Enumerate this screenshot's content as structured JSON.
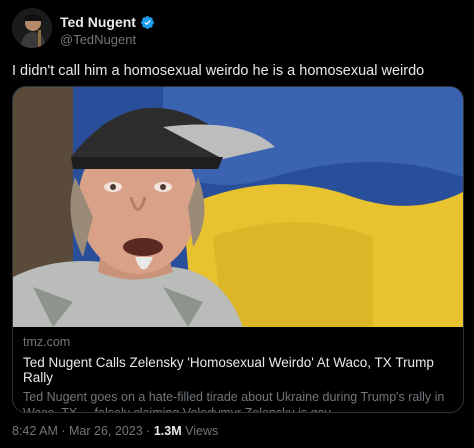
{
  "author": {
    "name": "Ted Nugent",
    "handle": "@TedNugent",
    "verified": true,
    "avatar_icon": "avatar-portrait-icon"
  },
  "tweet": {
    "text": "I didn't call him a homosexual weirdo he is a homosexual weirdo"
  },
  "card": {
    "domain": "tmz.com",
    "title": "Ted Nugent Calls Zelensky 'Homosexual Weirdo' At Waco, TX Trump Rally",
    "description": "Ted Nugent goes on a hate-filled tirade about Ukraine during Trump's rally in Waco, TX ... falsely claiming Volodymyr Zelensky is gay."
  },
  "meta": {
    "time": "8:42 AM",
    "date": "Mar 26, 2023",
    "separator": "·",
    "views_count": "1.3M",
    "views_label": "Views"
  },
  "colors": {
    "background": "#000000",
    "text": "#e7e9ea",
    "muted": "#71767b",
    "verified": "#1d9bf0",
    "flag_blue": "#2a4f9a",
    "flag_yellow": "#e9c22f"
  }
}
